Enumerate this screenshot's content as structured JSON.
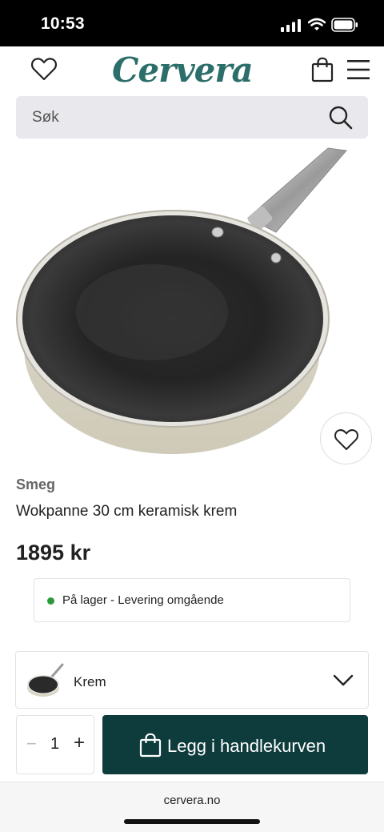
{
  "status": {
    "time": "10:53"
  },
  "header": {
    "logo": "Cervera"
  },
  "search": {
    "placeholder": "Søk"
  },
  "product": {
    "brand": "Smeg",
    "name": "Wokpanne 30 cm keramisk krem",
    "price": "1895 kr",
    "stock": "På lager - Levering omgående"
  },
  "variant": {
    "selected": "Krem"
  },
  "purchase": {
    "quantity": "1",
    "minus": "−",
    "plus": "+",
    "add_label": "Legg i handlekurven"
  },
  "browser": {
    "domain": "cervera.no"
  },
  "colors": {
    "brand": "#2c6e69",
    "button": "#0e3b3c",
    "stock": "#2b9a3a"
  }
}
